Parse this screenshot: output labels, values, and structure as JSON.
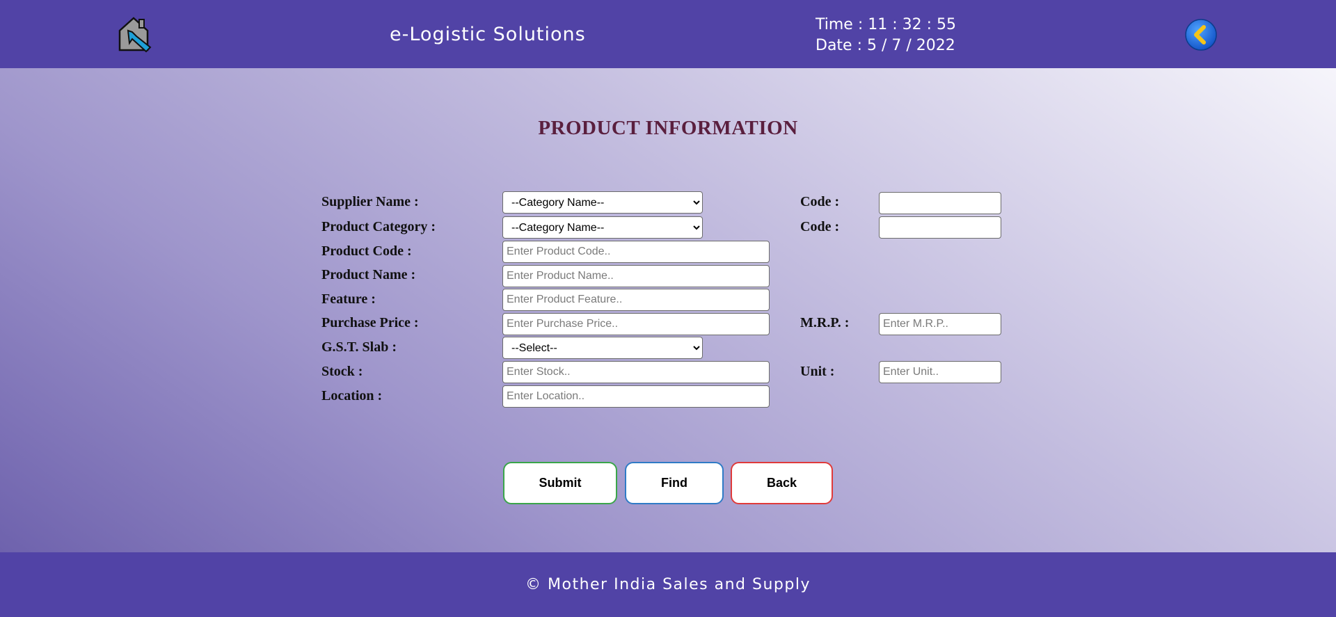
{
  "header": {
    "title": "e-Logistic Solutions",
    "time_text": "Time : 11 : 32 : 55",
    "date_text": "Date : 5 / 7 / 2022",
    "home_icon": "home-icon",
    "back_icon": "back-arrow-icon"
  },
  "page": {
    "title": "PRODUCT INFORMATION"
  },
  "form": {
    "supplier_name": {
      "label": "Supplier Name :",
      "selected": "--Category Name--"
    },
    "supplier_code": {
      "label": "Code :",
      "value": ""
    },
    "product_category": {
      "label": "Product Category :",
      "selected": "--Category Name--"
    },
    "category_code": {
      "label": "Code :",
      "value": ""
    },
    "product_code": {
      "label": "Product Code :",
      "placeholder": "Enter Product Code.."
    },
    "product_name": {
      "label": "Product Name :",
      "placeholder": "Enter Product Name.."
    },
    "feature": {
      "label": "Feature :",
      "placeholder": "Enter Product Feature.."
    },
    "purchase_price": {
      "label": "Purchase Price :",
      "placeholder": "Enter Purchase Price.."
    },
    "mrp": {
      "label": "M.R.P. :",
      "placeholder": "Enter M.R.P.."
    },
    "gst_slab": {
      "label": "G.S.T. Slab :",
      "selected": "--Select--"
    },
    "stock": {
      "label": "Stock :",
      "placeholder": "Enter Stock.."
    },
    "unit": {
      "label": "Unit :",
      "placeholder": "Enter Unit.."
    },
    "location": {
      "label": "Location :",
      "placeholder": "Enter Location.."
    }
  },
  "buttons": {
    "submit": "Submit",
    "find": "Find",
    "back": "Back"
  },
  "footer": {
    "copyright": "© Mother India Sales and Supply"
  },
  "colors": {
    "header_bg": "#5143a6",
    "title_color": "#5a1f3e",
    "submit_border": "#3aa54a",
    "find_border": "#2f7bc6",
    "back_border": "#e03a3a"
  }
}
